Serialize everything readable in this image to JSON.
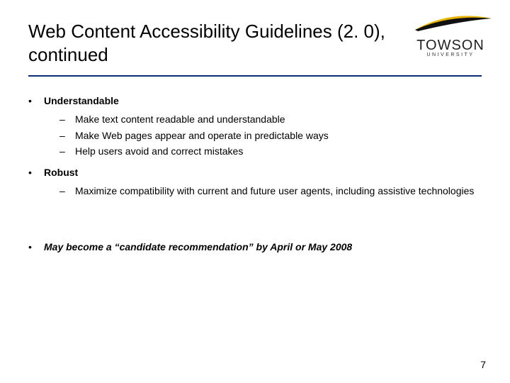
{
  "title": "Web Content Accessibility Guidelines (2. 0), continued",
  "logo": {
    "word": "TOWSON",
    "sub": "UNIVERSITY"
  },
  "sections": [
    {
      "heading": "Understandable",
      "style": "bold",
      "items": [
        "Make text content readable and understandable",
        "Make Web pages appear and operate in predictable ways",
        "Help users avoid and correct mistakes"
      ]
    },
    {
      "heading": "Robust",
      "style": "bold",
      "items": [
        "Maximize compatibility with current and future user agents, including assistive technologies"
      ]
    }
  ],
  "footnote": "May become a “candidate recommendation” by April or May 2008",
  "page_number": "7"
}
